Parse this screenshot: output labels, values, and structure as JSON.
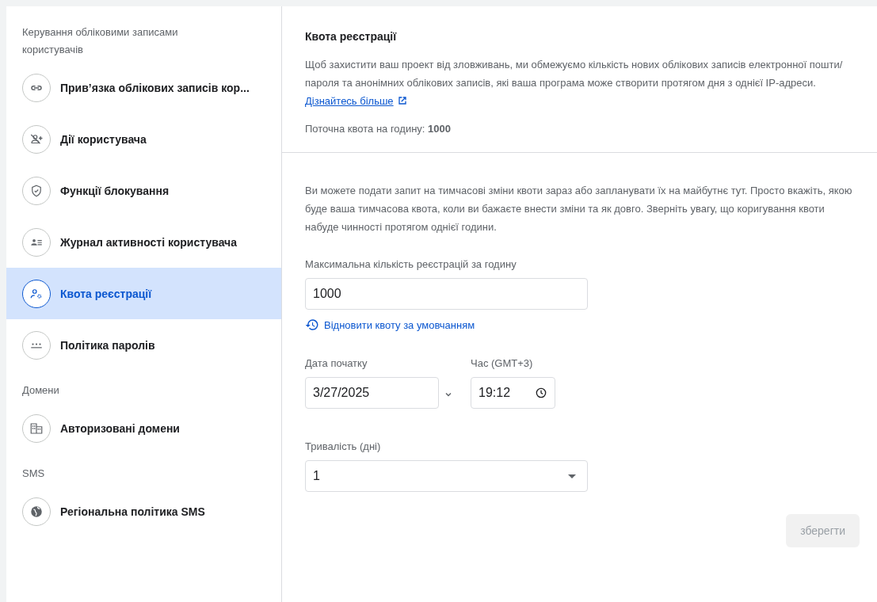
{
  "sidebar": {
    "groups": [
      {
        "heading": "Керування обліковими записами користувачів",
        "items": [
          {
            "label": "Прив’язка облікових записів кор...",
            "selected": false
          },
          {
            "label": "Дії користувача",
            "selected": false
          },
          {
            "label": "Функції блокування",
            "selected": false
          },
          {
            "label": "Журнал активності користувача",
            "selected": false
          },
          {
            "label": "Квота реєстрації",
            "selected": true
          },
          {
            "label": "Політика паролів",
            "selected": false
          }
        ]
      },
      {
        "heading": "Домени",
        "items": [
          {
            "label": "Авторизовані домени",
            "selected": false
          }
        ]
      },
      {
        "heading": "SMS",
        "items": [
          {
            "label": "Регіональна політика SMS",
            "selected": false
          }
        ]
      }
    ]
  },
  "quota": {
    "title": "Квота реєстрації",
    "description": "Щоб захистити ваш проект від зловживань, ми обмежуємо кількість нових облікових записів електронної пошти/пароля та анонімних облікових записів, які ваша програма може створити протягом дня з однієї IP-адреси.",
    "link": "Дізнайтесь більше",
    "current": "Поточна квота на годину: **1000**"
  },
  "form": {
    "intro": "Ви можете подати запит на тимчасові зміни квоти зараз або запланувати їх на майбутнє тут. Просто вкажіть, якою буде ваша тимчасова квота, коли ви бажаєте внести зміни та як довго. Зверніть увагу, що коригування квоти набуде чинності протягом однієї години.",
    "max_label": "Максимальна кількість реєстрацій за годину",
    "max_value": "1000",
    "restore": "Відновити квоту за умовчанням",
    "date_label": "Дата початку",
    "date_value": "3/27/2025",
    "time_label": "Час (GMT+3)",
    "time_value": "19:12",
    "duration_label": "Тривалість (дні)",
    "duration_value": "1",
    "save": {
      "label": "зберегти",
      "disabled": true
    }
  }
}
